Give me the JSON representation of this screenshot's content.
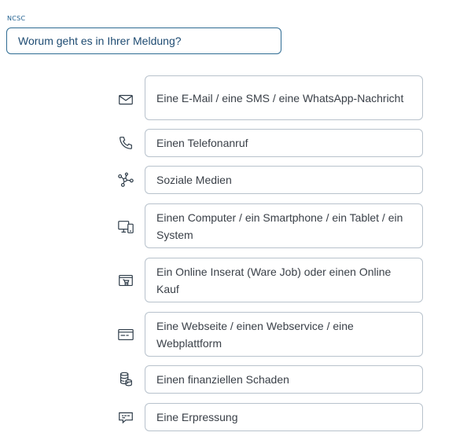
{
  "header": {
    "brand": "NCSC",
    "question": "Worum geht es in Ihrer Meldung?"
  },
  "options": [
    {
      "label": "Eine E-Mail / eine SMS / eine WhatsApp-Nachricht",
      "icon": "envelope-icon"
    },
    {
      "label": "Einen Telefonanruf",
      "icon": "phone-icon"
    },
    {
      "label": "Soziale Medien",
      "icon": "social-network-icon"
    },
    {
      "label": "Einen Computer / ein Smartphone / ein Tablet / ein System",
      "icon": "computer-devices-icon"
    },
    {
      "label": "Ein Online Inserat (Ware Job) oder einen Online Kauf",
      "icon": "shopping-cart-icon"
    },
    {
      "label": "Eine Webseite / einen Webservice / eine Webplattform",
      "icon": "browser-window-icon"
    },
    {
      "label": "Einen finanziellen Schaden",
      "icon": "coins-icon"
    },
    {
      "label": "Eine Erpressung",
      "icon": "ransom-message-icon"
    }
  ]
}
